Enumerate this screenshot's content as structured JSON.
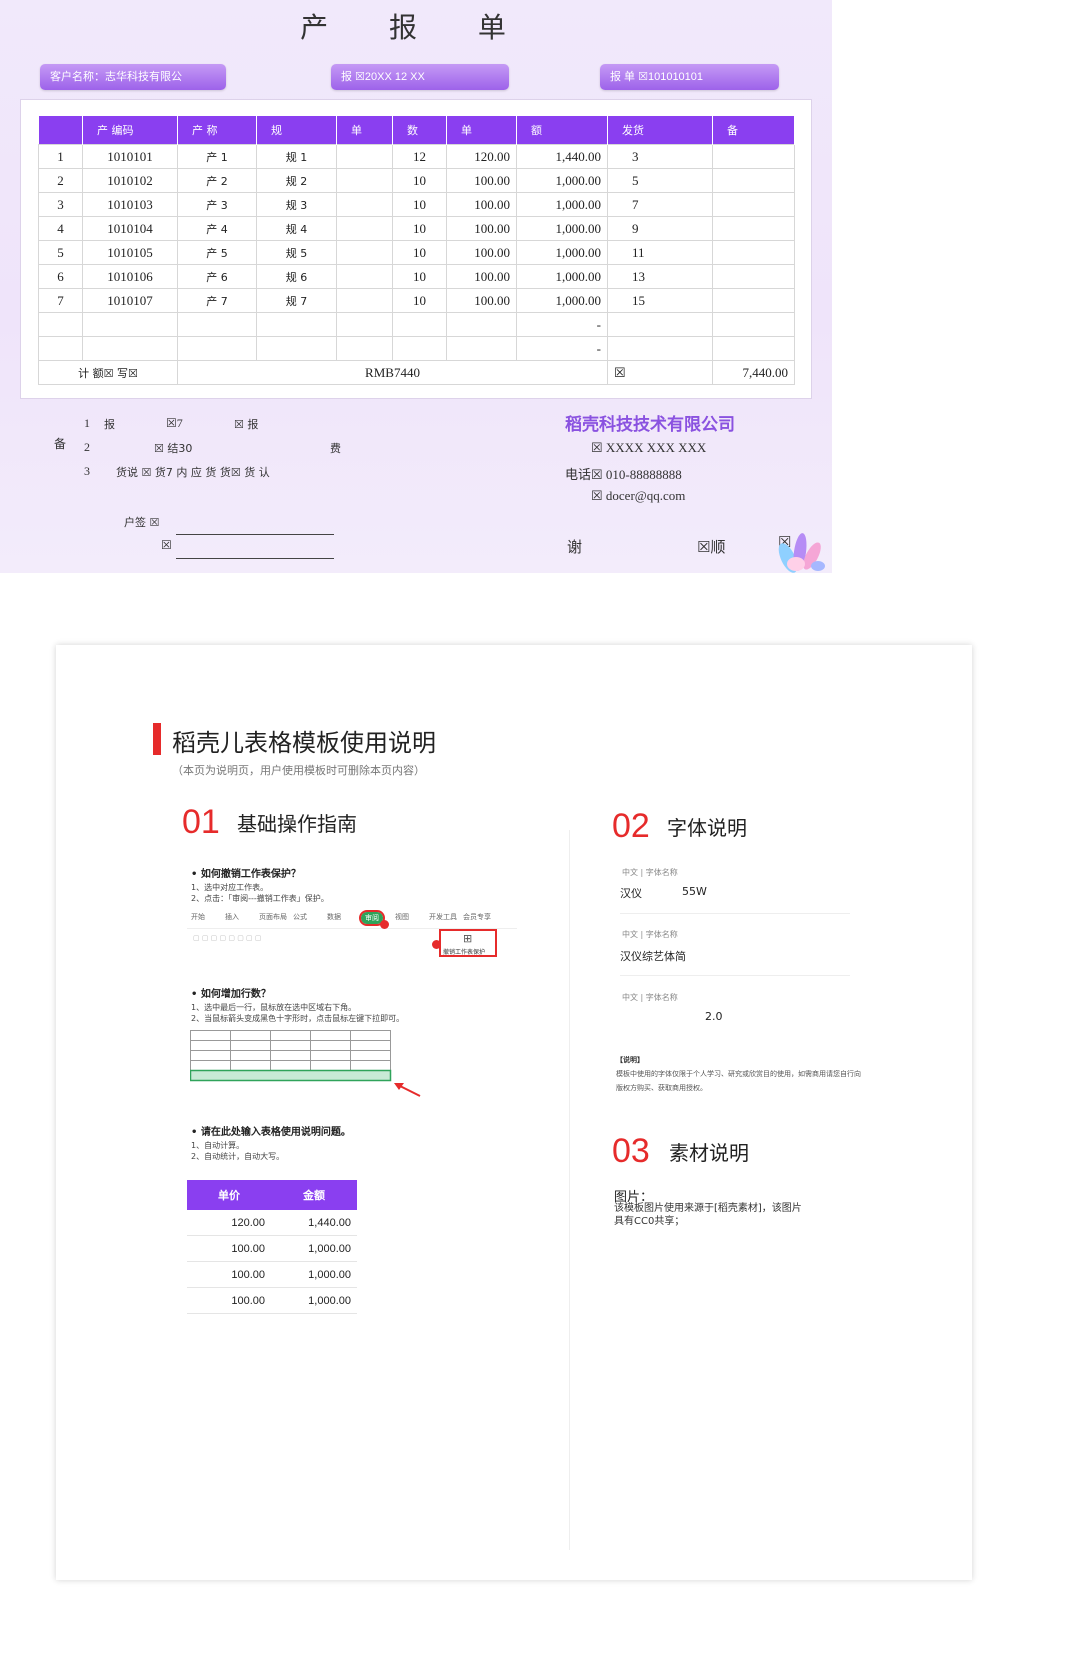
{
  "invoice": {
    "title": "产 报 单",
    "customer_pill": "客户名称：志华科技有限公",
    "date_pill": "报        ☒20XX   12   XX",
    "number_pill": "报    单    ☒101010101",
    "headers": [
      "",
      "产  编码",
      "产      称",
      "规",
      "单",
      "数",
      "单",
      "额",
      "发货",
      "备"
    ],
    "rows": [
      [
        "1",
        "1010101",
        "产   1",
        "规   1",
        "",
        "12",
        "120.00",
        "1,440.00",
        "3",
        ""
      ],
      [
        "2",
        "1010102",
        "产   2",
        "规   2",
        "",
        "10",
        "100.00",
        "1,000.00",
        "5",
        ""
      ],
      [
        "3",
        "1010103",
        "产   3",
        "规   3",
        "",
        "10",
        "100.00",
        "1,000.00",
        "7",
        ""
      ],
      [
        "4",
        "1010104",
        "产   4",
        "规   4",
        "",
        "10",
        "100.00",
        "1,000.00",
        "9",
        ""
      ],
      [
        "5",
        "1010105",
        "产   5",
        "规   5",
        "",
        "10",
        "100.00",
        "1,000.00",
        "11",
        ""
      ],
      [
        "6",
        "1010106",
        "产   6",
        "规   6",
        "",
        "10",
        "100.00",
        "1,000.00",
        "13",
        ""
      ],
      [
        "7",
        "1010107",
        "产   7",
        "规   7",
        "",
        "10",
        "100.00",
        "1,000.00",
        "15",
        ""
      ],
      [
        "",
        "",
        "",
        "",
        "",
        "",
        "",
        "-",
        "",
        ""
      ],
      [
        "",
        "",
        "",
        "",
        "",
        "",
        "",
        "-",
        "",
        ""
      ]
    ],
    "total_label": "计    额☒   写☒",
    "total_words": "RMB7440",
    "total_box": "☒",
    "total_value": "7,440.00",
    "notes_label": "备",
    "notes": [
      {
        "num": "1",
        "a": "报",
        "b": "☒7",
        "c": "☒   报"
      },
      {
        "num": "2",
        "a": "☒   结30",
        "b": "费"
      },
      {
        "num": "3",
        "a": "货说   ☒   货7   内      应   货      货☒           货   认"
      }
    ],
    "company": "稻壳科技技术有限公司",
    "address": "☒ XXXX   XXX       XXX",
    "phone": "电话☒ 010-88888888",
    "email": "☒ docer@qq.com",
    "sign_label": "户签   ☒",
    "sign_label2": "☒",
    "thanks": "谢",
    "thanks_right": "☒顺",
    "corner_box": "☒"
  },
  "guide": {
    "title": "稻壳儿表格模板使用说明",
    "subtitle": "（本页为说明页，用户使用模板时可删除本页内容）",
    "sections": {
      "s1": {
        "num": "01",
        "title": "基础操作指南"
      },
      "s2": {
        "num": "02",
        "title": "字体说明"
      },
      "s3": {
        "num": "03",
        "title": "素材说明"
      }
    },
    "q1": "•  如何撤销工作表保护？",
    "q1_steps": "1、选中对应工作表。\n2、点击：「审阅---撤销工作表」保护。",
    "ribbon_tabs": [
      "开始",
      "插入",
      "页面布局",
      "公式",
      "数据",
      "审阅",
      "视图",
      "开发工具",
      "会员专享"
    ],
    "ribbon_btn": "撤销工作表保护",
    "q2": "•  如何增加行数？",
    "q2_steps": "1、选中最后一行，鼠标放在选中区域右下角。\n2、当鼠标箭头变成黑色十字形时，点击鼠标左键下拉即可。",
    "q3": "•  请在此处输入表格使用说明问题。",
    "q3_steps": "1、自动计算。\n2、自动统计，自动大写。",
    "mini_headers": [
      "单价",
      "金额"
    ],
    "mini_rows": [
      [
        "120.00",
        "1,440.00"
      ],
      [
        "100.00",
        "1,000.00"
      ],
      [
        "100.00",
        "1,000.00"
      ],
      [
        "100.00",
        "1,000.00"
      ]
    ],
    "fonts": [
      {
        "caption": "中文 | 字体名称",
        "name": "汉仪",
        "extra": "55W"
      },
      {
        "caption": "中文 | 字体名称",
        "name": "汉仪综艺体简",
        "extra": ""
      },
      {
        "caption": "中文 | 字体名称",
        "name": "",
        "extra": "2.0"
      }
    ],
    "font_note_title": "【说明】",
    "font_note": "模板中使用的字体仅限于个人学习、研究或欣赏目的使用，如需商用请您自行向\n版权方购买、获取商用授权。",
    "material_title": "图片：",
    "material_text": "该模板图片使用来源于[稻壳素材]，该图片\n具有CC0共享；"
  },
  "colors": {
    "accent_purple": "#8a3ff0",
    "accent_red": "#e62b2b"
  }
}
